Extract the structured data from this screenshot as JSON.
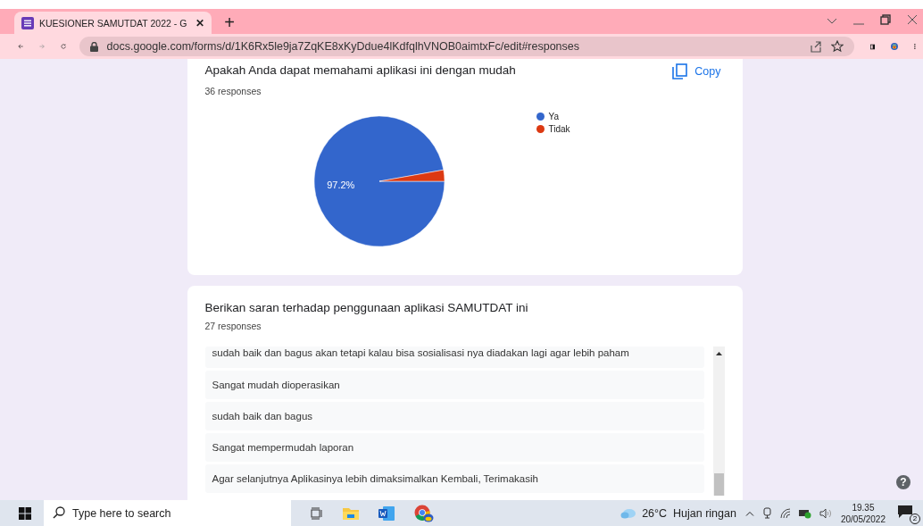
{
  "browser": {
    "tab": {
      "title": "KUESIONER SAMUTDAT 2022 - G",
      "close": "✕",
      "selected": true
    },
    "new_tab": "+",
    "address": "docs.google.com/forms/d/1K6Rx5le9ja7ZqKE8xKyDdue4lKdfqlhVNOB0aimtxFc/edit#responses"
  },
  "cards": [
    {
      "kind": "chart",
      "title": "Apakah Anda dapat memahami aplikasi ini dengan mudah",
      "count": "36 responses",
      "copy": "Copy",
      "chart_data": {
        "type": "pie",
        "categories": [
          "Ya",
          "Tidak"
        ],
        "values": [
          97.2,
          2.8
        ],
        "colors": [
          "#3366cc",
          "#dc3912"
        ],
        "value_labels": [
          "97.2%",
          null
        ],
        "legend": true
      }
    },
    {
      "kind": "text",
      "title": "Berikan saran terhadap penggunaan aplikasi SAMUTDAT ini",
      "count": "27 responses",
      "responses": [
        "sudah baik dan bagus akan tetapi kalau bisa sosialisasi nya diadakan lagi agar lebih paham",
        "Sangat mudah dioperasikan",
        "sudah baik dan bagus",
        "Sangat mempermudah laporan",
        "Agar selanjutnya Aplikasinya lebih dimaksimalkan Kembali, Terimakasih"
      ]
    }
  ],
  "help": "?",
  "taskbar": {
    "search_placeholder": "Type here to search",
    "weather": "26°C  Hujan ringan",
    "time": "19.35",
    "date": "20/05/2022",
    "notifications": "2"
  }
}
